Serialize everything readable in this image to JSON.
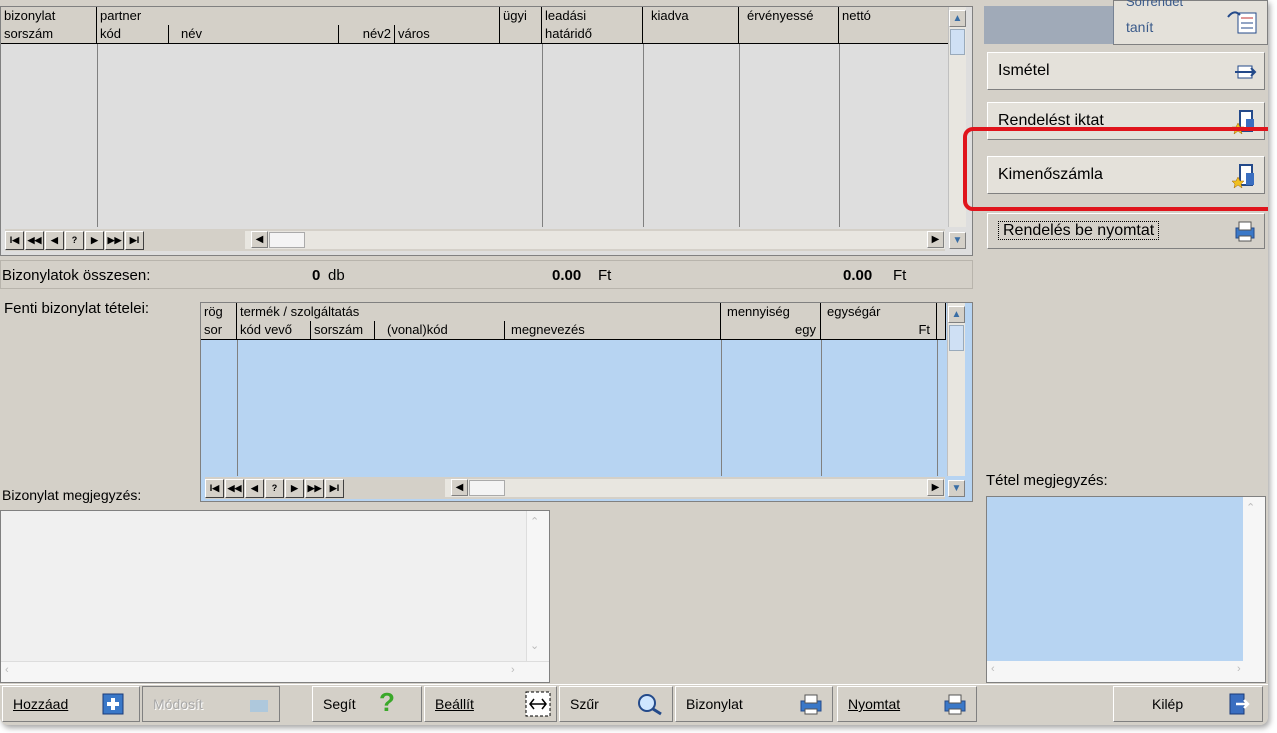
{
  "top_grid": {
    "header_row1": [
      "bizonylat",
      "partner",
      "ügyi",
      "leadási",
      "kiadva",
      "érvényessé",
      "nettó"
    ],
    "header_row2": [
      "sorszám",
      "kód",
      "név",
      "név2",
      "város",
      "határidő"
    ]
  },
  "nav_labels": [
    "I◀",
    "◀◀",
    "◀",
    "?",
    "▶",
    "▶▶",
    "▶I"
  ],
  "summary": {
    "label": "Bizonylatok összesen:",
    "count": "0",
    "count_unit": "db",
    "amount1": "0.00",
    "amount1_unit": "Ft",
    "amount2": "0.00",
    "amount2_unit": "Ft"
  },
  "items": {
    "label": "Fenti bizonylat tételei:",
    "header_row1": [
      "rög",
      "termék / szolgáltatás",
      "mennyiség",
      "egységár"
    ],
    "header_row2": [
      "sor",
      "kód vevő",
      "sorszám",
      "(vonal)kód",
      "megnevezés",
      "egy",
      "Ft"
    ]
  },
  "doc_note_label": "Bizonylat megjegyzés:",
  "item_note_label": "Tétel megjegyzés:",
  "right_panel": {
    "top_label_line1": "Sorrendet",
    "top_label_line2": "tanít",
    "buttons": [
      "Ismétel",
      "Rendelést iktat",
      "Kimenőszámla",
      "Rendelés be nyomtat"
    ]
  },
  "bottom_bar": {
    "add": "Hozzáad",
    "modify": "Módosít",
    "help": "Segít",
    "settings": "Beállít",
    "filter": "Szűr",
    "document": "Bizonylat",
    "print": "Nyomtat",
    "exit": "Kilép"
  },
  "colors": {
    "highlight": "#e0141c",
    "grid_blue": "#b7d4f2",
    "face": "#d4d0c8"
  }
}
